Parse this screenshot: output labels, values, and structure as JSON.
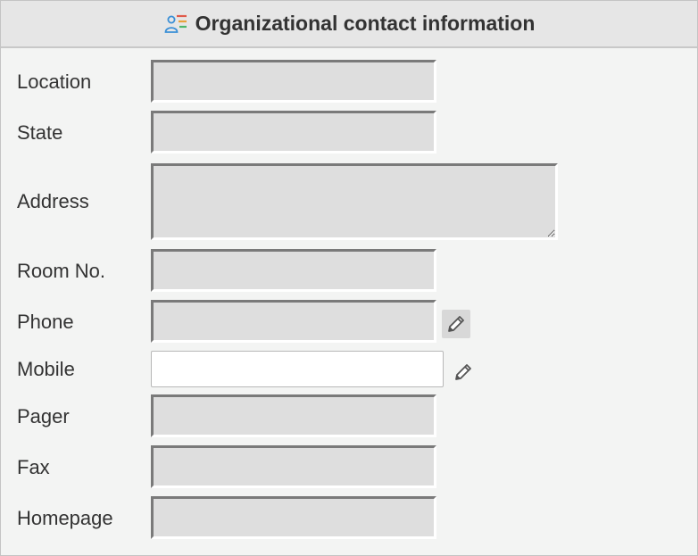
{
  "header": {
    "title": "Organizational contact information",
    "icon": "contact-list-icon"
  },
  "fields": {
    "location": {
      "label": "Location",
      "value": ""
    },
    "state": {
      "label": "State",
      "value": ""
    },
    "address": {
      "label": "Address",
      "value": ""
    },
    "room_no": {
      "label": "Room No.",
      "value": ""
    },
    "phone": {
      "label": "Phone",
      "value": "",
      "edit_icon": "pencil-icon"
    },
    "mobile": {
      "label": "Mobile",
      "value": "",
      "edit_icon": "pencil-icon"
    },
    "pager": {
      "label": "Pager",
      "value": ""
    },
    "fax": {
      "label": "Fax",
      "value": ""
    },
    "homepage": {
      "label": "Homepage",
      "value": ""
    }
  }
}
